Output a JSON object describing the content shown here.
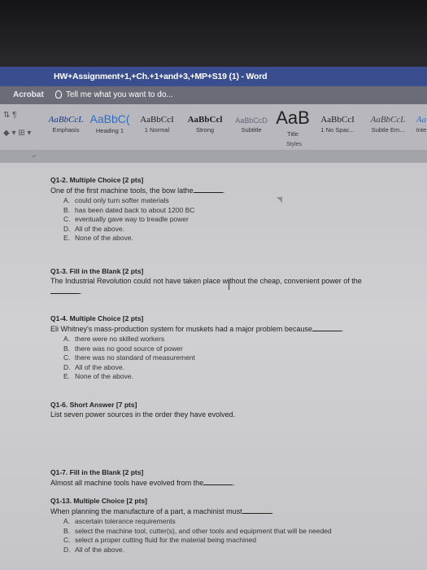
{
  "window": {
    "title": "HW+Assignment+1,+Ch.+1+and+3,+MP+S19 (1) - Word"
  },
  "ribbon_top": {
    "acrobat_label": "Acrobat",
    "tell_me_label": "Tell me what you want to do..."
  },
  "styles": {
    "items": [
      {
        "preview": "AaBbCcL",
        "name": "Emphasis"
      },
      {
        "preview": "AaBbC(",
        "name": "Heading 1"
      },
      {
        "preview": "AaBbCcI",
        "name": "1 Normal"
      },
      {
        "preview": "AaBbCcl",
        "name": "Strong"
      },
      {
        "preview": "AaBbCcD",
        "name": "Subtitle"
      },
      {
        "preview": "AaB",
        "name": "Title"
      },
      {
        "preview": "AaBbCcI",
        "name": "1 No Spac..."
      },
      {
        "preview": "AaBbCcL",
        "name": "Subtle Em..."
      },
      {
        "preview": "Aa",
        "name": "Inte"
      }
    ],
    "group_label": "Styles"
  },
  "document": {
    "q1": {
      "head": "Q1-2. Multiple Choice [2 pts]",
      "prompt": "One of the first machine tools, the bow lathe",
      "options": [
        {
          "letter": "A.",
          "text": "could only turn softer materials"
        },
        {
          "letter": "B.",
          "text": "has been dated back to about 1200 BC"
        },
        {
          "letter": "C.",
          "text": "eventually gave way to treadle power"
        },
        {
          "letter": "D.",
          "text": "All of the above."
        },
        {
          "letter": "E.",
          "text": "None of the above."
        }
      ]
    },
    "q2": {
      "head": "Q1-3. Fill in the Blank [2 pts]",
      "prompt": "The Industrial Revolution could not have taken place without the cheap, convenient power of the"
    },
    "q3": {
      "head": "Q1-4. Multiple Choice [2 pts]",
      "prompt": "Eli Whitney's mass-production system for muskets had a major problem because",
      "options": [
        {
          "letter": "A.",
          "text": "there were no skilled workers"
        },
        {
          "letter": "B.",
          "text": "there was no good source of power"
        },
        {
          "letter": "C.",
          "text": "there was no standard of measurement"
        },
        {
          "letter": "D.",
          "text": "All of the above."
        },
        {
          "letter": "E.",
          "text": "None of the above."
        }
      ]
    },
    "q4": {
      "head": "Q1-6. Short Answer [7 pts]",
      "prompt": "List seven power sources in the order they have evolved."
    },
    "q5": {
      "head": "Q1-7. Fill in the Blank [2 pts]",
      "prompt": "Almost all machine tools have evolved from the"
    },
    "q6": {
      "head": "Q1-13. Multiple Choice [2 pts]",
      "prompt": "When planning the manufacture of a part, a machinist must",
      "options": [
        {
          "letter": "A.",
          "text": "ascertain tolerance requirements"
        },
        {
          "letter": "B.",
          "text": "select the machine tool, cutter(s), and other tools and equipment that will be needed"
        },
        {
          "letter": "C.",
          "text": "select a proper cutting fluid for the material being machined"
        },
        {
          "letter": "D.",
          "text": "All of the above."
        }
      ]
    }
  }
}
